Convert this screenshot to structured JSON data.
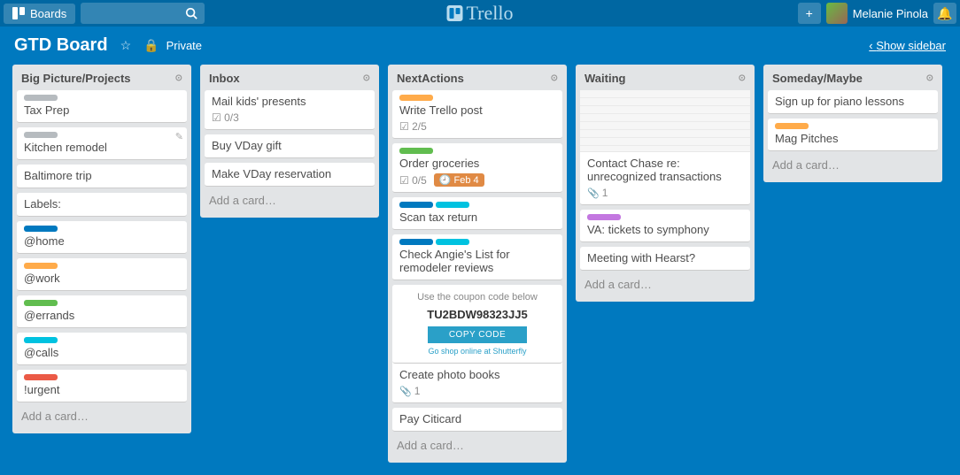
{
  "topbar": {
    "boards_label": "Boards",
    "logo_text": "Trello",
    "username": "Melanie Pinola"
  },
  "board_header": {
    "title": "GTD Board",
    "privacy": "Private",
    "show_sidebar": "Show sidebar"
  },
  "add_card_text": "Add a card…",
  "lists": [
    {
      "title": "Big Picture/Projects",
      "cards": [
        {
          "labels": [
            "grey"
          ],
          "title": "Tax Prep"
        },
        {
          "labels": [
            "grey"
          ],
          "title": "Kitchen remodel",
          "edit_hover": true
        },
        {
          "labels": [],
          "title": "Baltimore trip"
        },
        {
          "labels": [],
          "title": "Labels:"
        },
        {
          "labels": [
            "blue"
          ],
          "title": "@home"
        },
        {
          "labels": [
            "orange"
          ],
          "title": "@work"
        },
        {
          "labels": [
            "green"
          ],
          "title": "@errands"
        },
        {
          "labels": [
            "sky"
          ],
          "title": "@calls"
        },
        {
          "labels": [
            "red"
          ],
          "title": "!urgent"
        }
      ]
    },
    {
      "title": "Inbox",
      "cards": [
        {
          "labels": [],
          "title": "Mail kids' presents",
          "checklist": "0/3"
        },
        {
          "labels": [],
          "title": "Buy VDay gift"
        },
        {
          "labels": [],
          "title": "Make VDay reservation"
        }
      ]
    },
    {
      "title": "NextActions",
      "cards": [
        {
          "labels": [
            "orange"
          ],
          "title": "Write Trello post",
          "checklist": "2/5"
        },
        {
          "labels": [
            "green"
          ],
          "title": "Order groceries",
          "checklist": "0/5",
          "due": "Feb 4"
        },
        {
          "labels": [
            "blue",
            "sky"
          ],
          "title": "Scan tax return"
        },
        {
          "labels": [
            "blue",
            "sky"
          ],
          "title": "Check Angie's List for remodeler reviews"
        },
        {
          "type": "coupon",
          "prompt": "Use the coupon code below",
          "code": "TU2BDW98323JJ5",
          "button": "COPY CODE",
          "fineprint": "Go shop online at Shutterfly",
          "title": "Create photo books",
          "attachments": 1
        },
        {
          "labels": [],
          "title": "Pay Citicard"
        }
      ]
    },
    {
      "title": "Waiting",
      "cards": [
        {
          "type": "cover",
          "title": "Contact Chase re: unrecognized transactions",
          "attachments": 1
        },
        {
          "labels": [
            "purple"
          ],
          "title": "VA: tickets to symphony"
        },
        {
          "labels": [],
          "title": "Meeting with Hearst?"
        }
      ]
    },
    {
      "title": "Someday/Maybe",
      "cards": [
        {
          "labels": [],
          "title": "Sign up for piano lessons"
        },
        {
          "labels": [
            "orange"
          ],
          "title": "Mag Pitches"
        }
      ]
    }
  ]
}
